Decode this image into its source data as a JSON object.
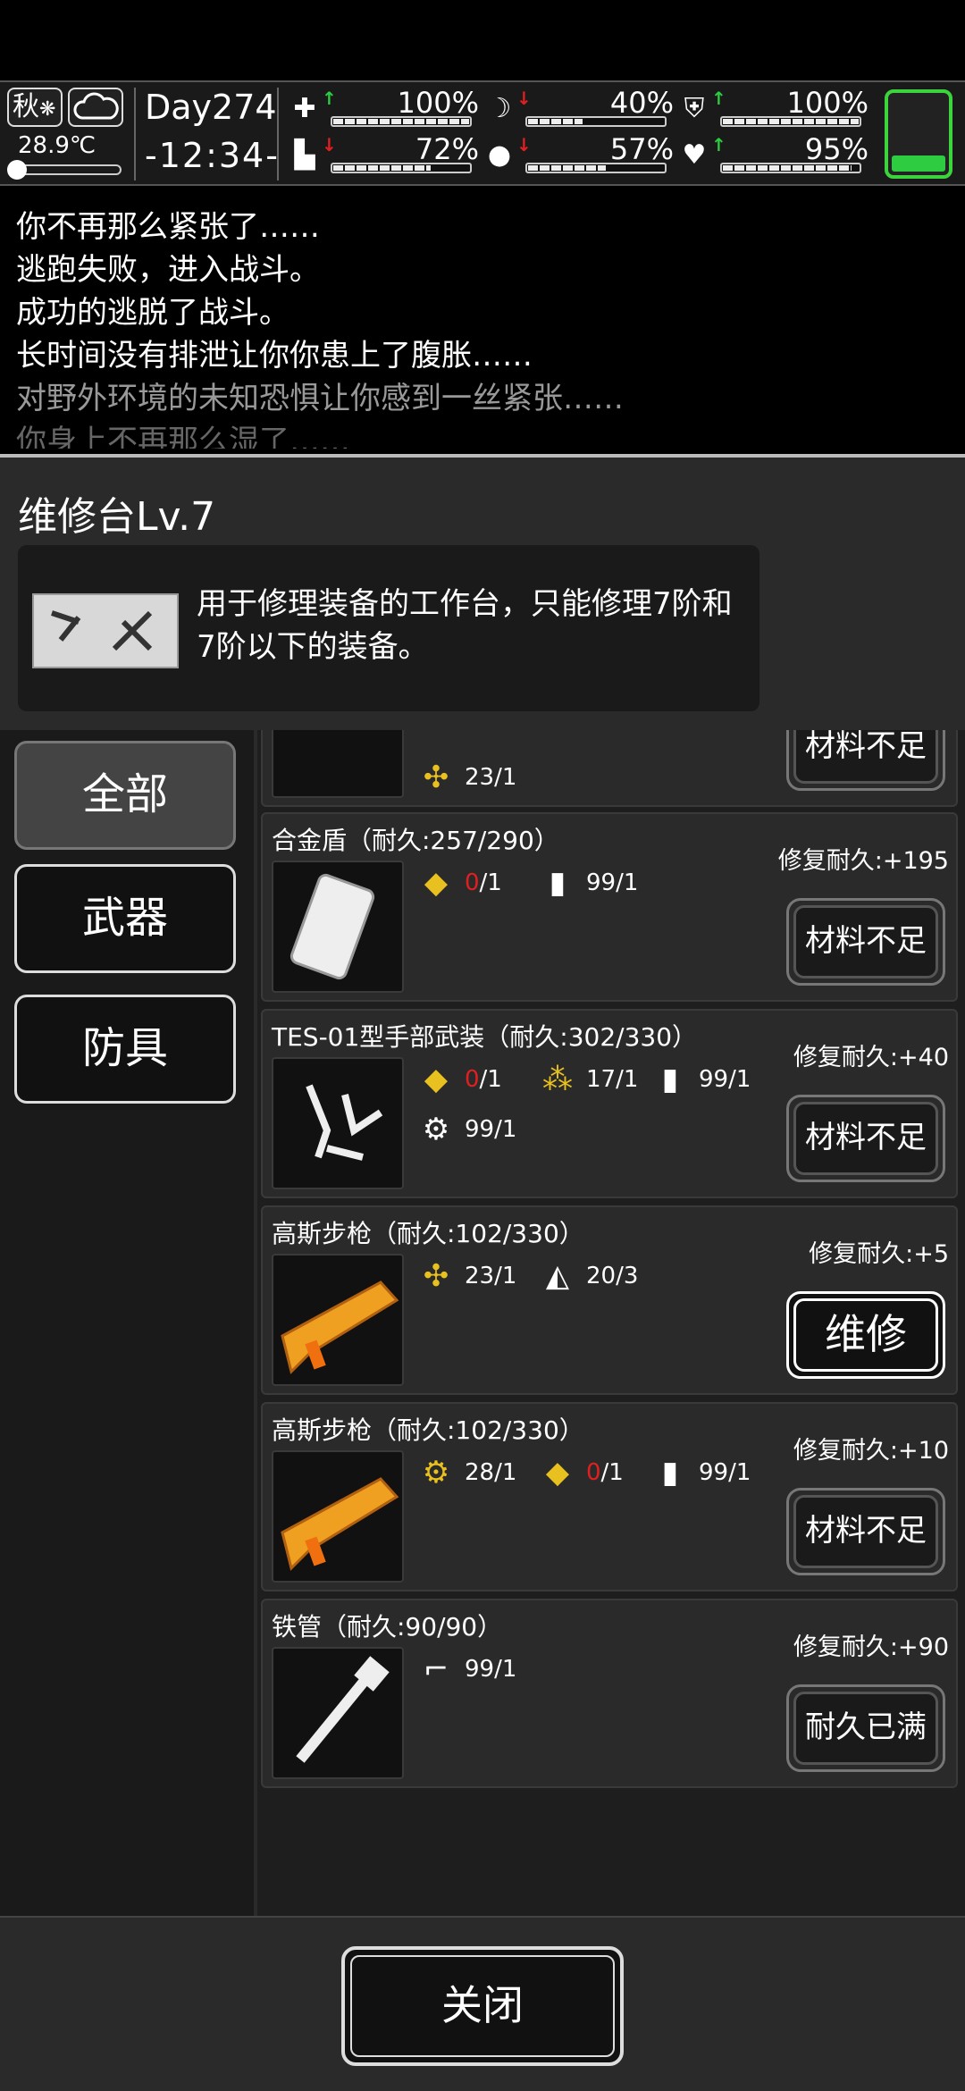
{
  "status": {
    "season": "秋",
    "temperature": "28.9℃",
    "day": "Day274",
    "time": "-12:34-",
    "stats": [
      {
        "icon": "medkit-icon",
        "trend": "up",
        "value": "100%",
        "level": 1.0
      },
      {
        "icon": "stomach-icon",
        "trend": "down",
        "value": "40%",
        "level": 0.4
      },
      {
        "icon": "shield-icon",
        "trend": "up",
        "value": "100%",
        "level": 1.0
      },
      {
        "icon": "boot-icon",
        "trend": "down",
        "value": "72%",
        "level": 0.72
      },
      {
        "icon": "water-drop-icon",
        "trend": "down",
        "value": "57%",
        "level": 0.57
      },
      {
        "icon": "heart-icon",
        "trend": "up",
        "value": "95%",
        "level": 0.95
      }
    ],
    "battery_level": 0.2
  },
  "log": {
    "lines": [
      "你不再那么紧张了……",
      "逃跑失败，进入战斗。",
      "成功的逃脱了战斗。",
      "长时间没有排泄让你你患上了腹胀……",
      "对野外环境的未知恐惧让你感到一丝紧张……",
      "你身上不再那么湿了……"
    ]
  },
  "panel": {
    "title": "维修台Lv.7",
    "description": "用于修理装备的工作台，只能修理7阶和7阶以下的装备。"
  },
  "categories": [
    "全部",
    "武器",
    "防具"
  ],
  "items": [
    {
      "name": "",
      "repair": "",
      "mats": [
        {
          "icon": "parts-icon",
          "count": "23/1",
          "short": false
        }
      ],
      "button": "材料不足",
      "active": false
    },
    {
      "name": "合金盾（耐久:257/290）",
      "repair": "修复耐久:+195",
      "mats": [
        {
          "icon": "gold-plate-icon",
          "have": "0",
          "need": "/1",
          "short": true
        },
        {
          "icon": "fuel-can-icon",
          "count": "99/1",
          "short": false
        }
      ],
      "button": "材料不足",
      "active": false
    },
    {
      "name": "TES-01型手部武装（耐久:302/330）",
      "repair": "修复耐久:+40",
      "mats": [
        {
          "icon": "gold-plate-icon",
          "have": "0",
          "need": "/1",
          "short": true
        },
        {
          "icon": "gold-scrap-icon",
          "count": "17/1",
          "short": false
        },
        {
          "icon": "fuel-can-icon",
          "count": "99/1",
          "short": false
        },
        {
          "icon": "gun-parts-icon",
          "count": "99/1",
          "short": false
        }
      ],
      "button": "材料不足",
      "active": false
    },
    {
      "name": "高斯步枪（耐久:102/330）",
      "repair": "修复耐久:+5",
      "mats": [
        {
          "icon": "parts-icon",
          "count": "23/1",
          "short": false
        },
        {
          "icon": "cloth-icon",
          "count": "20/3",
          "short": false
        }
      ],
      "button": "维修",
      "active": true
    },
    {
      "name": "高斯步枪（耐久:102/330）",
      "repair": "修复耐久:+10",
      "mats": [
        {
          "icon": "gear-icon",
          "count": "28/1",
          "short": false
        },
        {
          "icon": "gold-plate-icon",
          "have": "0",
          "need": "/1",
          "short": true
        },
        {
          "icon": "fuel-can-icon",
          "count": "99/1",
          "short": false
        }
      ],
      "button": "材料不足",
      "active": false
    },
    {
      "name": "铁管（耐久:90/90）",
      "repair": "修复耐久:+90",
      "mats": [
        {
          "icon": "pipe-fitting-icon",
          "count": "99/1",
          "short": false
        }
      ],
      "button": "耐久已满",
      "active": false
    }
  ],
  "footer": {
    "close": "关闭"
  }
}
